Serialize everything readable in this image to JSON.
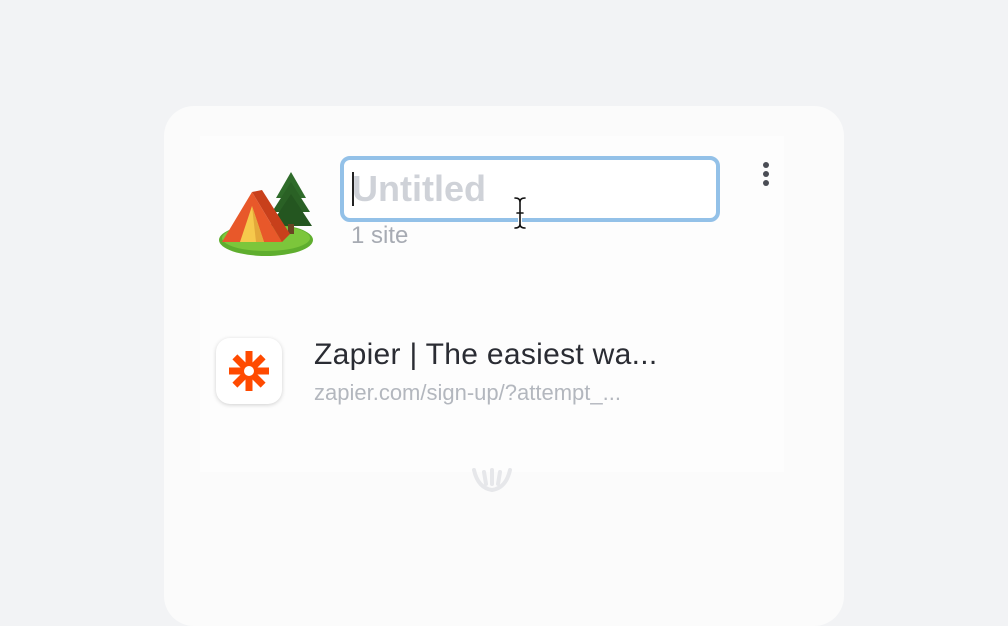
{
  "collection": {
    "icon": "camping-tent-emoji",
    "title_placeholder": "Untitled",
    "title_value": "",
    "site_count": "1 site",
    "more_icon": "vertical-ellipsis-icon"
  },
  "sites": [
    {
      "favicon": "zapier-logo",
      "favicon_color": "#ff4a00",
      "title": "Zapier | The easiest wa...",
      "url": "zapier.com/sign-up/?attempt_..."
    }
  ],
  "colors": {
    "focus_ring": "#93c1e8",
    "background": "#f2f3f5"
  }
}
